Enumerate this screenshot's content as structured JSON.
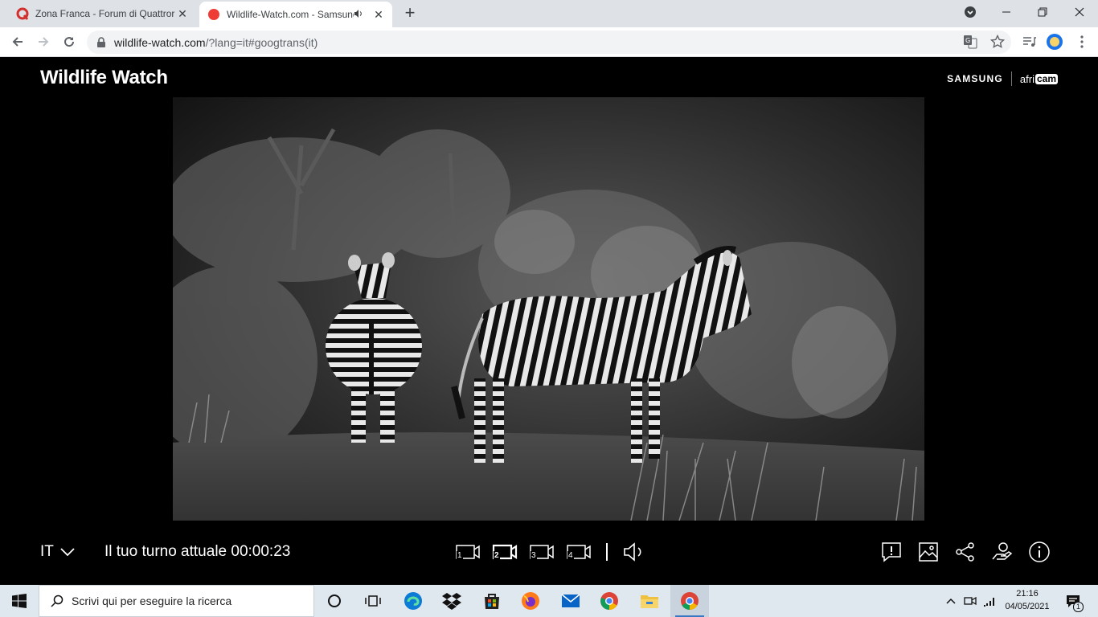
{
  "browser": {
    "tabs": [
      {
        "title": "Zona Franca - Forum di Quattroruote",
        "favicon": "quattroruote-q-icon",
        "active": false
      },
      {
        "title": "Wildlife-Watch.com - Samsung",
        "favicon": "red-dot-icon",
        "active": true,
        "audio": true
      }
    ],
    "url_host": "wildlife-watch.com",
    "url_path": "/?lang=it#googtrans(it)"
  },
  "site": {
    "title": "Wildlife Watch",
    "brand_samsung": "SAMSUNG",
    "brand_africam_prefix": "afri",
    "brand_africam_suffix": "cam"
  },
  "controls": {
    "language": "IT",
    "turn_label": "Il tuo turno attuale 00:00:23",
    "cameras": [
      {
        "number": "1",
        "selected": false
      },
      {
        "number": "2",
        "selected": true
      },
      {
        "number": "3",
        "selected": false
      },
      {
        "number": "4",
        "selected": false
      }
    ]
  },
  "taskbar": {
    "search_placeholder": "Scrivi qui per eseguire la ricerca",
    "time": "21:16",
    "date": "04/05/2021",
    "notification_count": "1"
  }
}
